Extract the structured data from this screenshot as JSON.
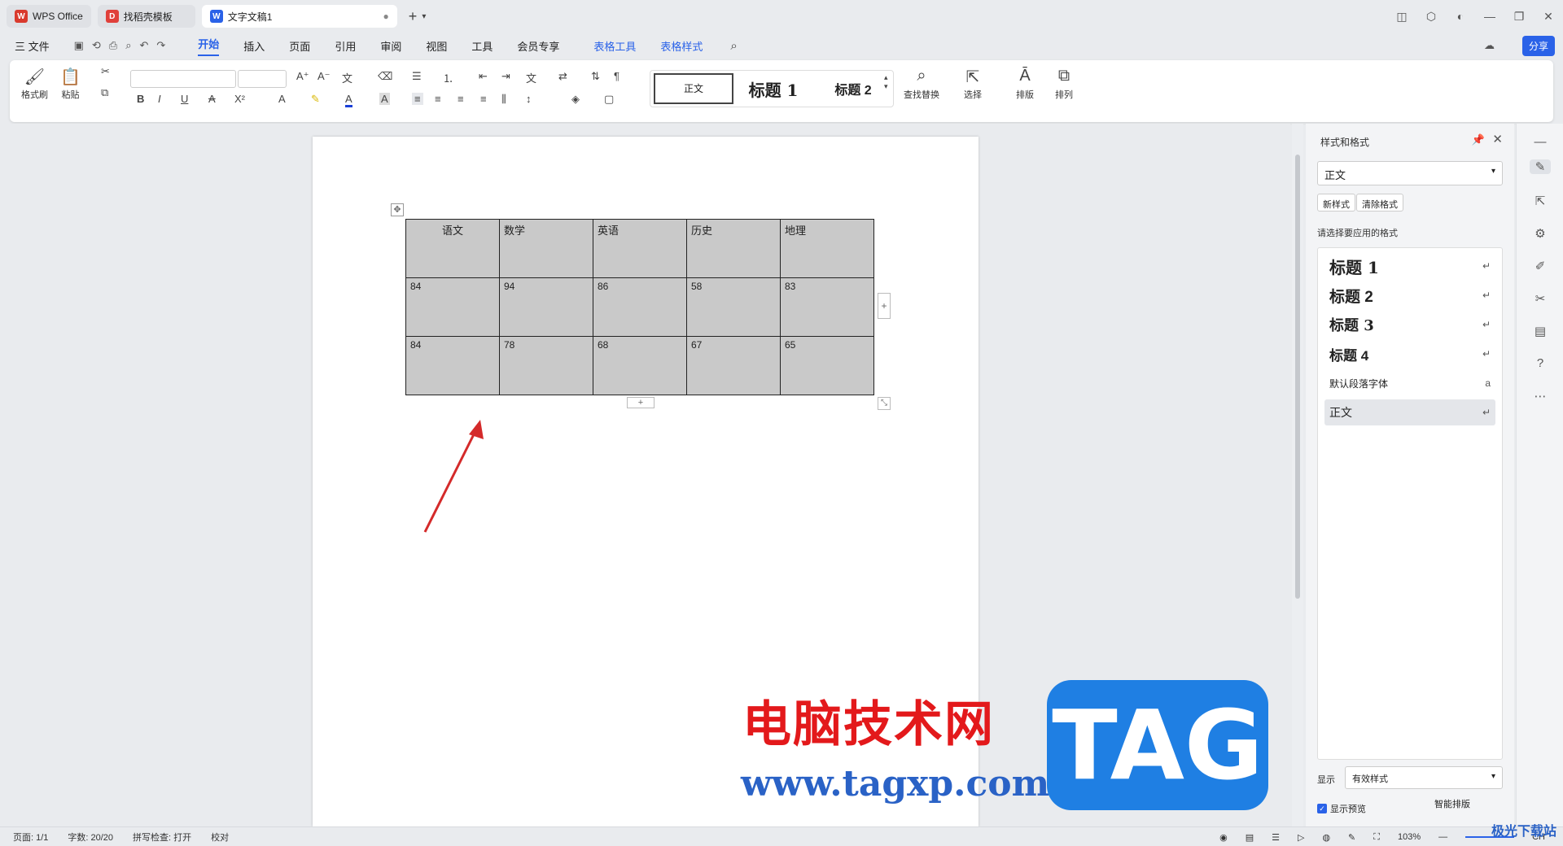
{
  "tabs": [
    {
      "label": "WPS Office",
      "logo": "W",
      "color": "#d93a2d"
    },
    {
      "label": "找稻壳模板",
      "logo": "D",
      "color": "#e0403a"
    },
    {
      "label": "文字文稿1",
      "logo": "W",
      "color": "#2a62e8"
    }
  ],
  "menu": {
    "file": "三 文件",
    "items": [
      "开始",
      "插入",
      "页面",
      "引用",
      "审阅",
      "视图",
      "工具",
      "会员专享"
    ],
    "table_tools": [
      "表格工具",
      "表格样式"
    ],
    "share": "分享"
  },
  "ribbon": {
    "format_painter": "格式刷",
    "paste": "粘贴",
    "styles": [
      "正文",
      "标题 1",
      "标题 2"
    ],
    "find_replace": "查找替换",
    "select": "选择",
    "layout": "排版",
    "arrange": "排列"
  },
  "table": {
    "rows": [
      [
        "语文",
        "数学",
        "英语",
        "历史",
        "地理"
      ],
      [
        "84",
        "94",
        "86",
        "58",
        "83"
      ],
      [
        "84",
        "78",
        "68",
        "67",
        "65"
      ]
    ]
  },
  "panel": {
    "title": "样式和格式",
    "current_style": "正文",
    "new_style": "新样式",
    "clear_format": "清除格式",
    "hint": "请选择要应用的格式",
    "styles": [
      {
        "label": "标题 1",
        "size": 20
      },
      {
        "label": "标题 2",
        "size": 19
      },
      {
        "label": "标题 3",
        "size": 18
      },
      {
        "label": "标题 4",
        "size": 17
      },
      {
        "label": "默认段落字体",
        "size": 12
      },
      {
        "label": "正文",
        "size": 14
      }
    ],
    "show_label": "显示",
    "show_value": "有效样式",
    "preview": "显示预览",
    "smart": "智能排版"
  },
  "status": {
    "page": "页面: 1/1",
    "words": "字数: 20/20",
    "spell": "拼写检查: 打开",
    "proof": "校对",
    "zoom": "103%",
    "lang": "CH"
  },
  "watermark": {
    "cn": "电脑技术网",
    "url": "www.tagxp.com",
    "tag": "TAG",
    "corner": "极光下载站"
  }
}
